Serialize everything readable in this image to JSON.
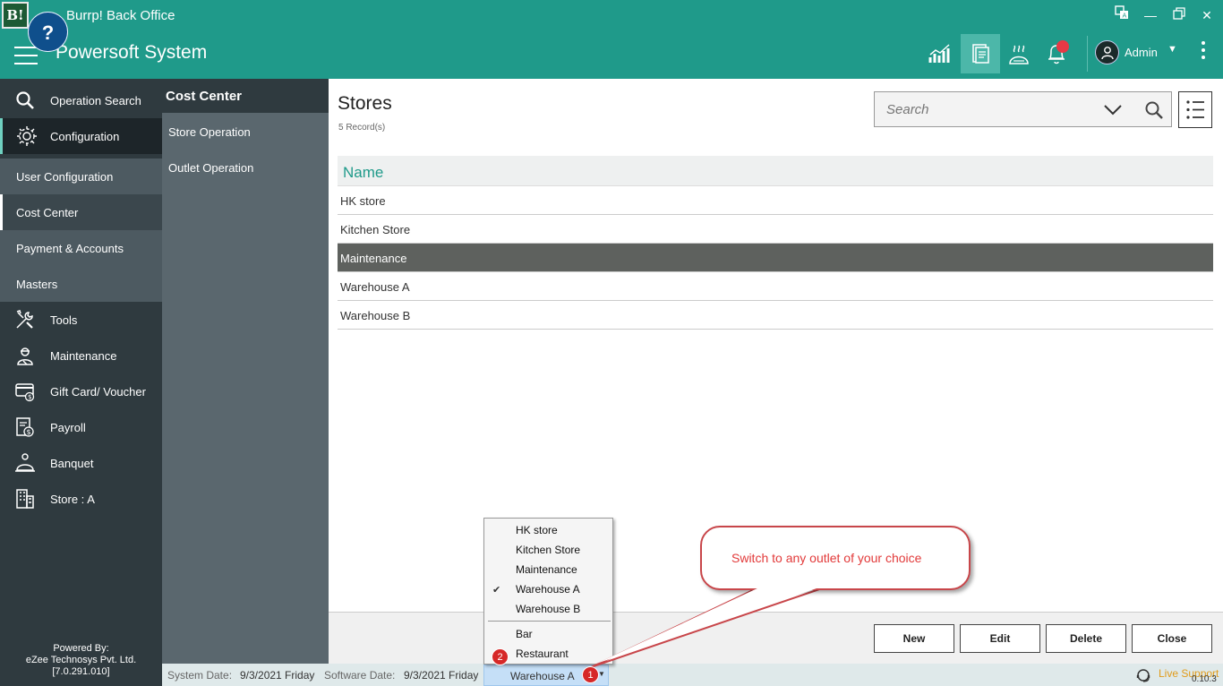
{
  "window": {
    "logo_text": "B!",
    "title": "Burrp! Back Office",
    "help_label": "?"
  },
  "header": {
    "company": "Powersoft System",
    "user_name": "Admin"
  },
  "leftnav": {
    "items": [
      {
        "label": "Operation Search",
        "icon": "search-icon"
      },
      {
        "label": "Configuration",
        "icon": "gear-icon"
      },
      {
        "label": "User Configuration"
      },
      {
        "label": "Cost Center"
      },
      {
        "label": "Payment & Accounts"
      },
      {
        "label": "Masters"
      },
      {
        "label": "Tools",
        "icon": "tools-icon"
      },
      {
        "label": "Maintenance",
        "icon": "maintenance-icon"
      },
      {
        "label": "Gift Card/ Voucher",
        "icon": "gift-card-icon"
      },
      {
        "label": "Payroll",
        "icon": "payroll-icon"
      },
      {
        "label": "Banquet",
        "icon": "banquet-icon"
      },
      {
        "label": "Store : A",
        "icon": "store-icon"
      }
    ],
    "powered_by": [
      "Powered By:",
      "eZee Technosys Pvt. Ltd.",
      "[7.0.291.010]"
    ]
  },
  "panel2": {
    "title": "Cost Center",
    "items": [
      "Store Operation",
      "Outlet Operation"
    ]
  },
  "main": {
    "title": "Stores",
    "record_count": "5 Record(s)",
    "search_placeholder": "Search",
    "column_header": "Name",
    "rows": [
      "HK store",
      "Kitchen Store",
      "Maintenance",
      "Warehouse A",
      "Warehouse B"
    ],
    "selected_row": "Maintenance"
  },
  "actions": {
    "new": "New",
    "edit": "Edit",
    "delete": "Delete",
    "close": "Close"
  },
  "statusbar": {
    "system_date_label": "System Date:",
    "system_date": "9/3/2021 Friday",
    "software_date_label": "Software Date:",
    "software_date": "9/3/2021 Friday",
    "outlet_selected": "Warehouse A",
    "live_support": "Live Support",
    "version": "0.10.3"
  },
  "dropdown": {
    "stores": [
      "HK store",
      "Kitchen Store",
      "Maintenance",
      "Warehouse A",
      "Warehouse B"
    ],
    "checked": "Warehouse A",
    "outlets": [
      "Bar",
      "Restaurant"
    ]
  },
  "annotations": {
    "badge_1": "1",
    "badge_2": "2",
    "callout": "Switch to any outlet of your choice"
  },
  "colors": {
    "header_teal": "#1f9a8a",
    "nav_dark": "#2f3a3f",
    "selected_row": "#5e615e",
    "callout_red": "#c8464a"
  }
}
